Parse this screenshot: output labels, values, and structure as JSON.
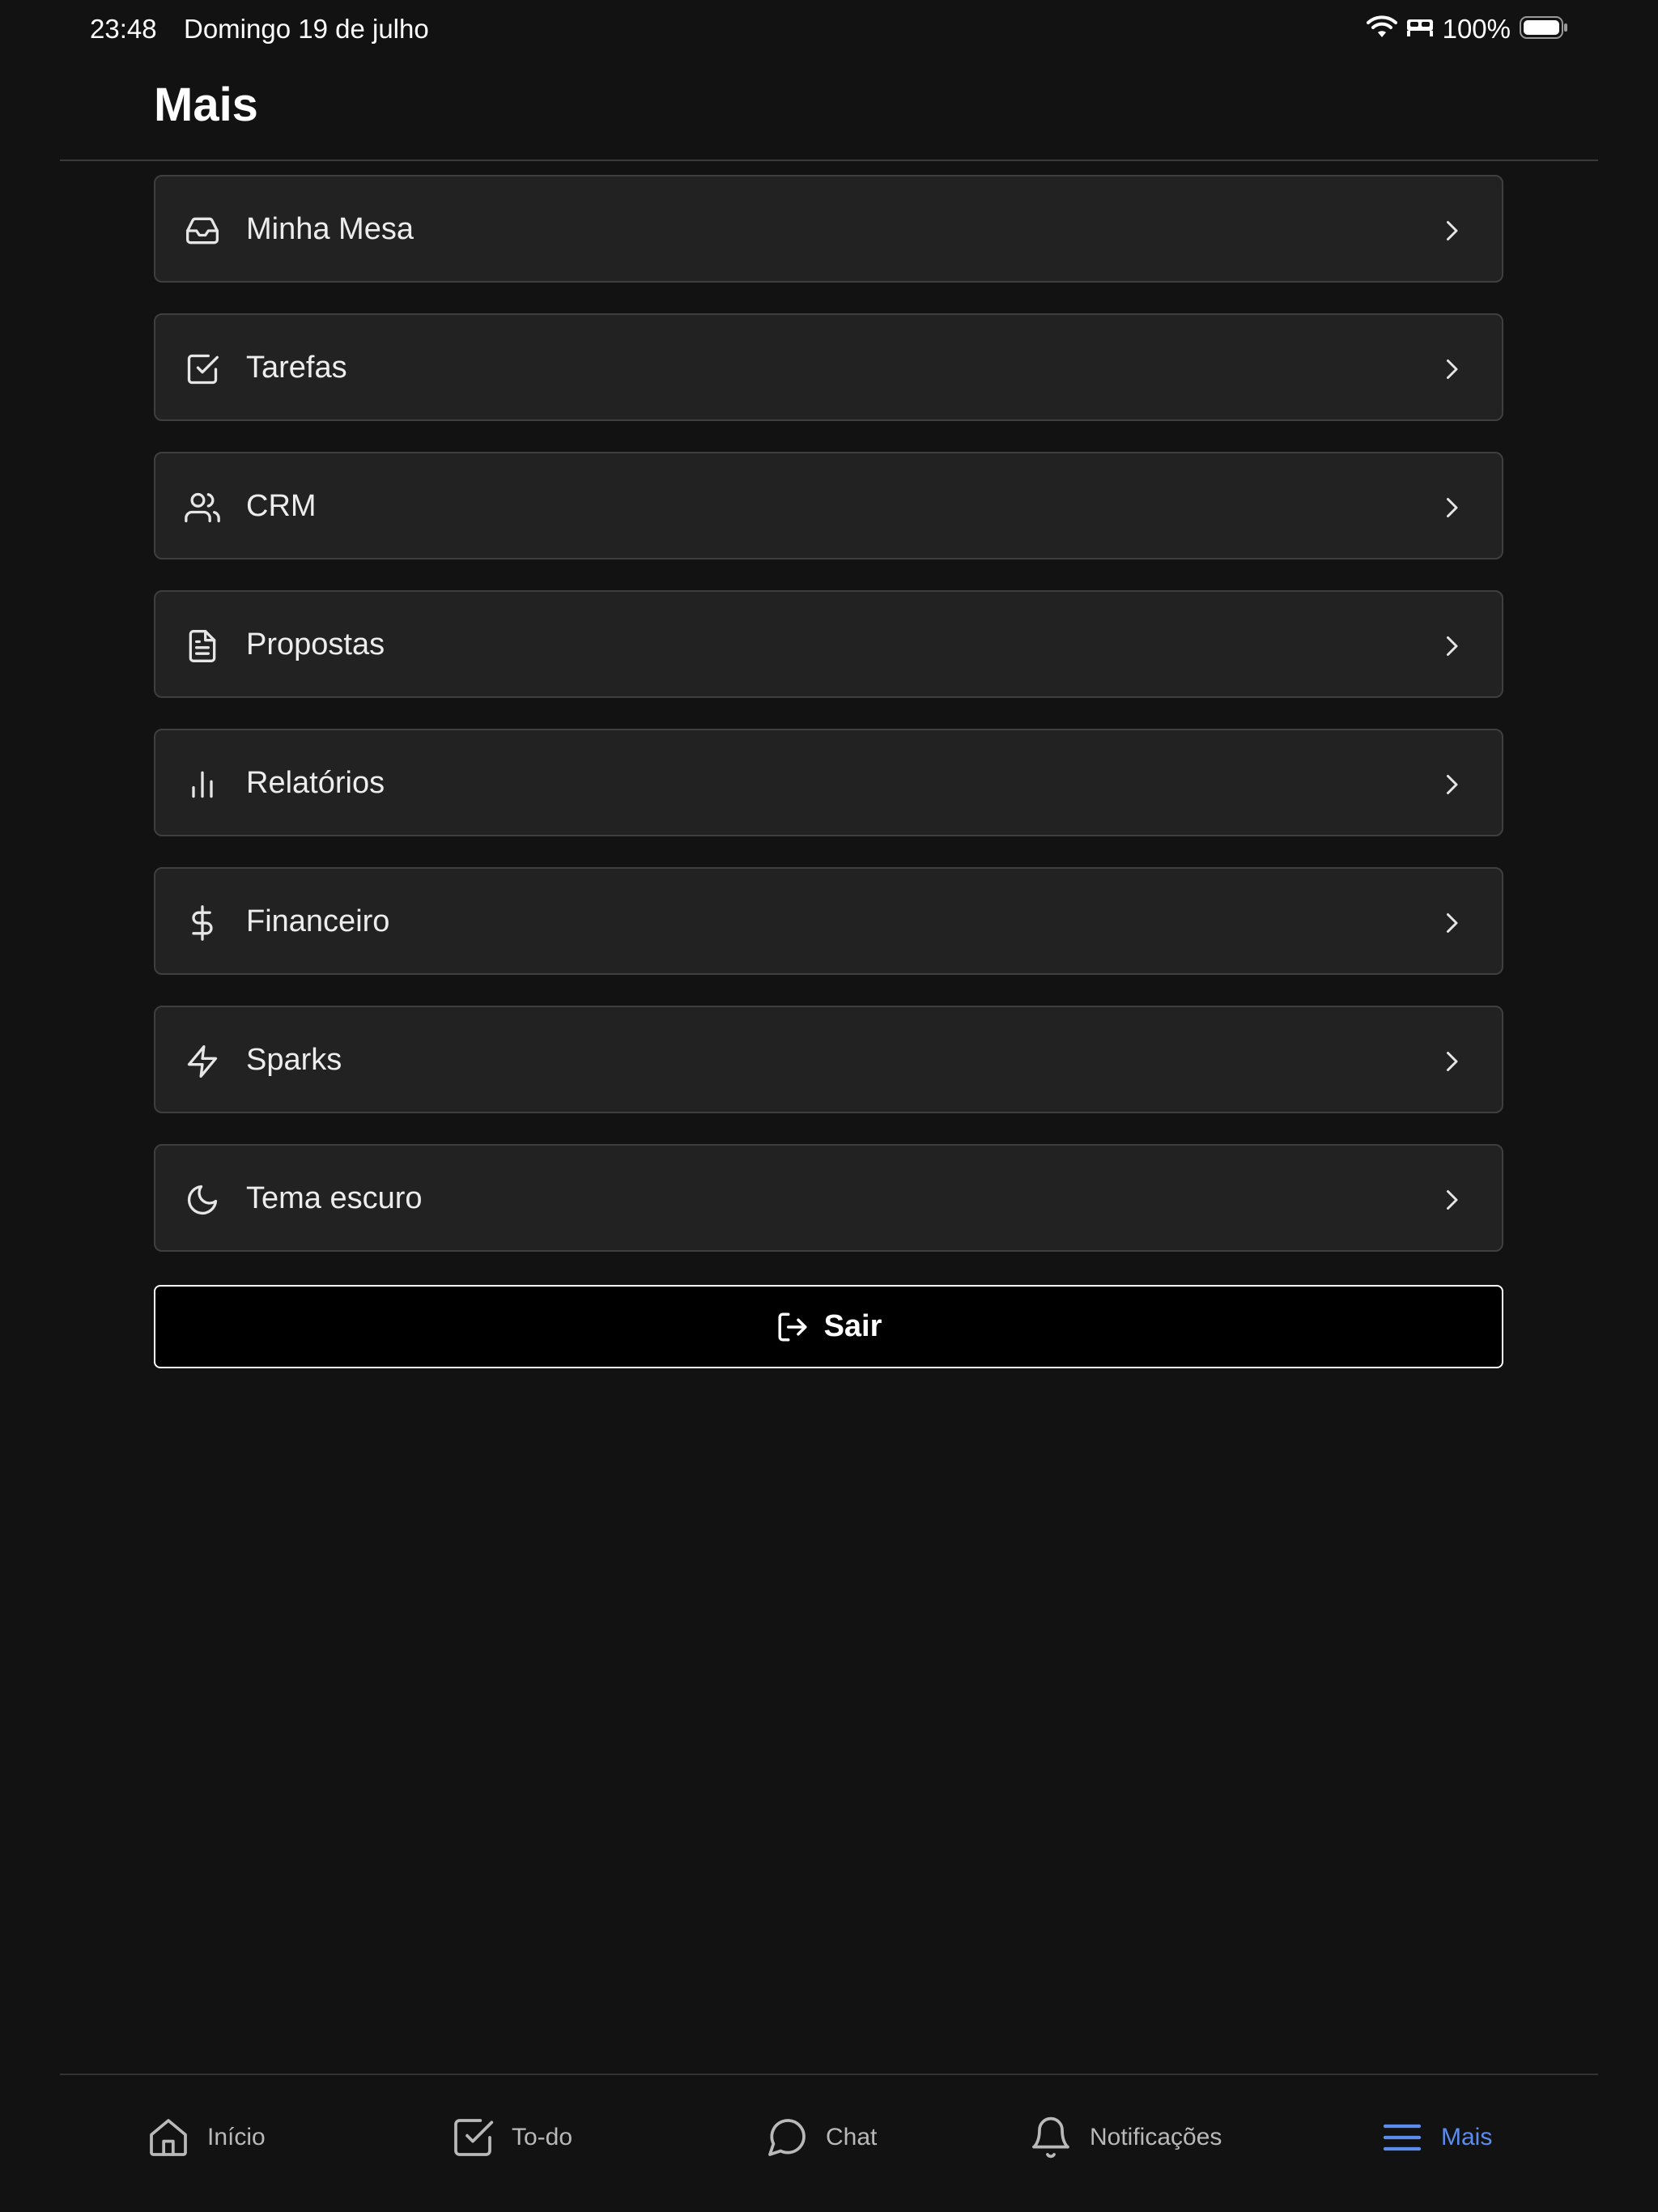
{
  "status_bar": {
    "time": "23:48",
    "date": "Domingo 19 de julho",
    "battery": "100%",
    "icons": [
      "wifi-icon",
      "bed-icon",
      "battery-icon"
    ]
  },
  "header": {
    "title": "Mais"
  },
  "menu": {
    "items": [
      {
        "label": "Minha Mesa",
        "icon": "inbox-icon"
      },
      {
        "label": "Tarefas",
        "icon": "checkbox-icon"
      },
      {
        "label": "CRM",
        "icon": "users-icon"
      },
      {
        "label": "Propostas",
        "icon": "document-icon"
      },
      {
        "label": "Relatórios",
        "icon": "bar-chart-icon"
      },
      {
        "label": "Financeiro",
        "icon": "dollar-icon"
      },
      {
        "label": "Sparks",
        "icon": "lightning-icon"
      },
      {
        "label": "Tema escuro",
        "icon": "moon-icon"
      }
    ]
  },
  "logout": {
    "label": "Sair",
    "icon": "logout-icon"
  },
  "bottom_nav": {
    "items": [
      {
        "label": "Início",
        "icon": "home-icon",
        "active": false
      },
      {
        "label": "To-do",
        "icon": "checkbox-icon",
        "active": false
      },
      {
        "label": "Chat",
        "icon": "chat-bubble-icon",
        "active": false
      },
      {
        "label": "Notificações",
        "icon": "bell-icon",
        "active": false
      },
      {
        "label": "Mais",
        "icon": "menu-icon",
        "active": true
      }
    ]
  },
  "colors": {
    "background": "#121212",
    "card": "#222223",
    "card_border": "#3f3f42",
    "accent": "#5b8def",
    "text": "#ededed",
    "nav_inactive": "#b9b9b9"
  }
}
